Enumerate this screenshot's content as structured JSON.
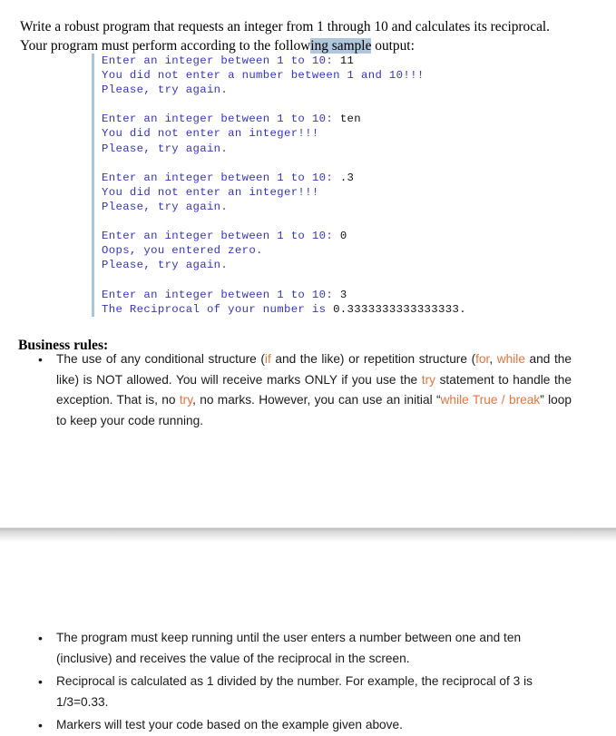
{
  "document": {
    "intro": {
      "line1_before": "Write a robust program that requests an integer from 1 through 10 and calculates its reciprocal. Your program must perform according to the follow",
      "highlighted": "ing sample",
      "line1_after": " output:"
    },
    "console_sample": {
      "name": "sample-output",
      "text_color": "#3333cc",
      "input_color": "#111111",
      "border_color": "#a8c4e0",
      "lines": [
        {
          "prompt": "Enter an integer between 1 to 10: ",
          "input": "11"
        },
        {
          "prompt": "You did not enter a number between 1 and 10!!!",
          "input": ""
        },
        {
          "prompt": "Please, try again.",
          "input": ""
        },
        {
          "prompt": "",
          "input": ""
        },
        {
          "prompt": "Enter an integer between 1 to 10: ",
          "input": "ten"
        },
        {
          "prompt": "You did not enter an integer!!!",
          "input": ""
        },
        {
          "prompt": "Please, try again.",
          "input": ""
        },
        {
          "prompt": "",
          "input": ""
        },
        {
          "prompt": "Enter an integer between 1 to 10: ",
          "input": ".3"
        },
        {
          "prompt": "You did not enter an integer!!!",
          "input": ""
        },
        {
          "prompt": "Please, try again.",
          "input": ""
        },
        {
          "prompt": "",
          "input": ""
        },
        {
          "prompt": "Enter an integer between 1 to 10: ",
          "input": "0"
        },
        {
          "prompt": "Oops, you entered zero.",
          "input": ""
        },
        {
          "prompt": "Please, try again.",
          "input": ""
        },
        {
          "prompt": "",
          "input": ""
        },
        {
          "prompt": "Enter an integer between 1 to 10: ",
          "input": "3"
        },
        {
          "prompt": "The Reciprocal of your number is ",
          "input": "0.3333333333333333."
        }
      ]
    },
    "business_rules": {
      "heading": "Business rules:",
      "keyword_color": "#e8743b",
      "items_first": [
        {
          "bullet": "•",
          "segments": [
            {
              "text": "The use of any conditional structure (",
              "kw": false
            },
            {
              "text": "if",
              "kw": true
            },
            {
              "text": " and the like) or repetition structure (",
              "kw": false
            },
            {
              "text": "for",
              "kw": true
            },
            {
              "text": ", ",
              "kw": false
            },
            {
              "text": "while",
              "kw": true
            },
            {
              "text": " and the like) is NOT allowed. You will receive marks ONLY if you use the ",
              "kw": false
            },
            {
              "text": "try",
              "kw": true
            },
            {
              "text": " statement to handle the exception. That is, no ",
              "kw": false
            },
            {
              "text": "try",
              "kw": true
            },
            {
              "text": ", no marks. However, you can use an initial “",
              "kw": false
            },
            {
              "text": "while True / break",
              "kw": true
            },
            {
              "text": "” loop to keep your code running.",
              "kw": false
            }
          ]
        }
      ],
      "items_second": [
        {
          "bullet": "•",
          "segments": [
            {
              "text": "The program must keep running until the user enters a number between one and ten (inclusive) and receives the value of the reciprocal in the screen.",
              "kw": false
            }
          ]
        },
        {
          "bullet": "•",
          "segments": [
            {
              "text": "Reciprocal is calculated as 1 divided by the number. For example, the reciprocal of 3 is 1/3=0.33.",
              "kw": false
            }
          ]
        },
        {
          "bullet": "•",
          "segments": [
            {
              "text": "Markers will test your code based on the example given above.",
              "kw": false
            }
          ]
        }
      ]
    },
    "page_break": {
      "name": "page-break-separator"
    }
  }
}
